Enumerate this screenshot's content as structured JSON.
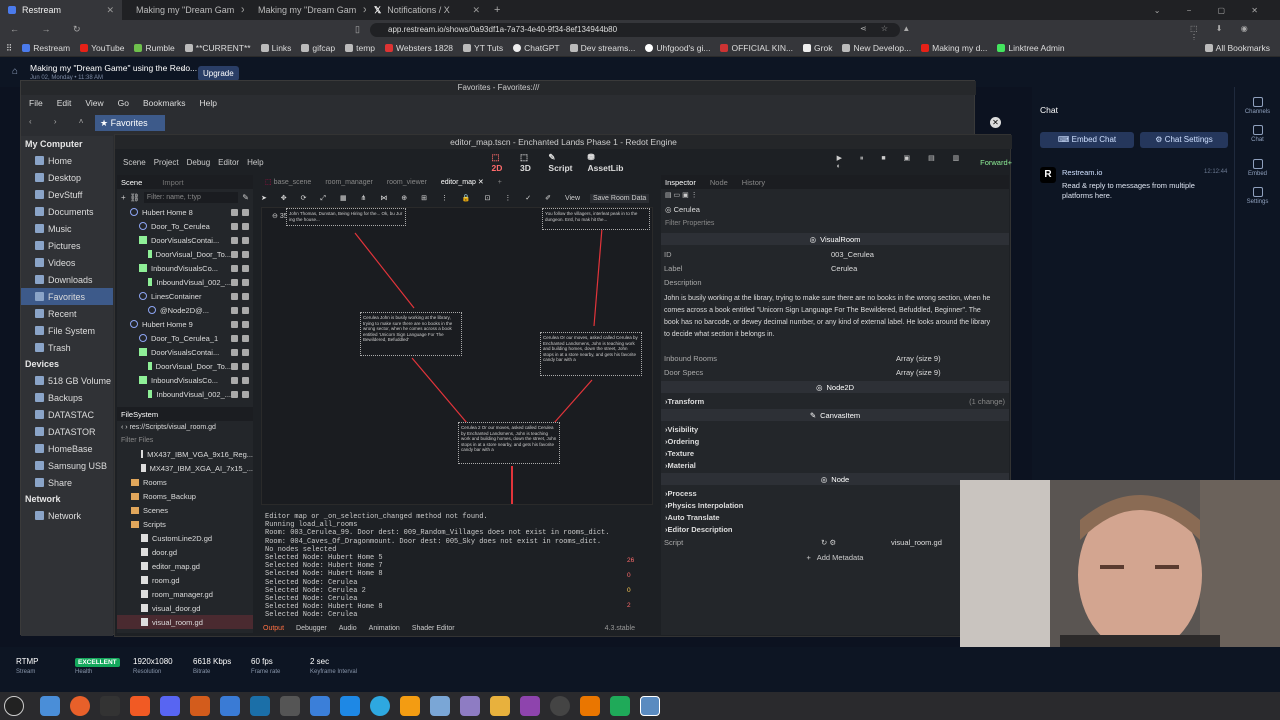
{
  "browser": {
    "tabs": [
      "Restream",
      "Making my \"Dream Gam",
      "Making my \"Dream Gam",
      "Notifications / X"
    ],
    "url": "app.restream.io/shows/0a93df1a-7a73-4e40-9f34-8ef134944b80",
    "bookmarks": [
      "Restream",
      "YouTube",
      "Rumble",
      "**CURRENT**",
      "Links",
      "gifcap",
      "temp",
      "Websters 1828",
      "YT Tuts",
      "ChatGPT",
      "Dev streams...",
      "Uhfgood's gi...",
      "OFFICIAL KIN...",
      "Grok",
      "New Develop...",
      "Making my d...",
      "Linktree Admin"
    ],
    "all_bookmarks": "All Bookmarks"
  },
  "restream": {
    "title": "Making my \"Dream Game\" using the Redo...",
    "subtitle": "Jun 02, Monday • 11:38 AM",
    "upgrade": "Upgrade"
  },
  "filemanager": {
    "title": "Favorites - Favorites:///",
    "menu": [
      "File",
      "Edit",
      "View",
      "Go",
      "Bookmarks",
      "Help"
    ],
    "location": "Favorites",
    "sidebar": {
      "my_computer": "My Computer",
      "places": [
        "Home",
        "Desktop",
        "DevStuff",
        "Documents",
        "Music",
        "Pictures",
        "Videos",
        "Downloads",
        "Favorites",
        "Recent",
        "File System",
        "Trash"
      ],
      "devices_h": "Devices",
      "devices": [
        "518 GB Volume",
        "Backups",
        "DATASTAC",
        "DATASTOR",
        "HomeBase",
        "Samsung USB",
        "Share"
      ],
      "network_h": "Network",
      "network": [
        "Network"
      ]
    }
  },
  "godot": {
    "title": "editor_map.tscn - Enchanted Lands Phase 1 - Redot Engine",
    "menu": [
      "Scene",
      "Project",
      "Debug",
      "Editor",
      "Help"
    ],
    "modes": [
      "2D",
      "3D",
      "Script",
      "AssetLib"
    ],
    "renderer": "Forward+",
    "scene_tabs": [
      "Scene",
      "Import"
    ],
    "filter_placeholder": "Filter: name, t:typ",
    "tree": [
      {
        "n": "Hubert Home 8",
        "t": "n",
        "d": 1
      },
      {
        "n": "Door_To_Cerulea",
        "t": "n",
        "d": 2
      },
      {
        "n": "DoorVisualsContai...",
        "t": "g",
        "d": 2
      },
      {
        "n": "DoorVisual_Door_To...",
        "t": "g",
        "d": 3
      },
      {
        "n": "InboundVisualsCo...",
        "t": "g",
        "d": 2
      },
      {
        "n": "InboundVisual_002_...",
        "t": "g",
        "d": 3
      },
      {
        "n": "LinesContainer",
        "t": "n",
        "d": 2
      },
      {
        "n": "@Node2D@...",
        "t": "n",
        "d": 3
      },
      {
        "n": "Hubert Home 9",
        "t": "n",
        "d": 1
      },
      {
        "n": "Door_To_Cerulea_1",
        "t": "n",
        "d": 2
      },
      {
        "n": "DoorVisualsContai...",
        "t": "g",
        "d": 2
      },
      {
        "n": "DoorVisual_Door_To...",
        "t": "g",
        "d": 3
      },
      {
        "n": "InboundVisualsCo...",
        "t": "g",
        "d": 2
      },
      {
        "n": "InboundVisual_002_...",
        "t": "g",
        "d": 3
      }
    ],
    "filesystem": {
      "title": "FileSystem",
      "path": "res://Scripts/visual_room.gd",
      "filter": "Filter Files",
      "items": [
        {
          "n": "MX437_IBM_VGA_9x16_Reg...",
          "t": "f",
          "d": 1
        },
        {
          "n": "MX437_IBM_XGA_AI_7x15_...",
          "t": "f",
          "d": 1
        },
        {
          "n": "Rooms",
          "t": "d",
          "d": 0
        },
        {
          "n": "Rooms_Backup",
          "t": "d",
          "d": 0
        },
        {
          "n": "Scenes",
          "t": "d",
          "d": 0
        },
        {
          "n": "Scripts",
          "t": "d",
          "d": 0
        },
        {
          "n": "CustomLine2D.gd",
          "t": "f",
          "d": 1
        },
        {
          "n": "door.gd",
          "t": "f",
          "d": 1
        },
        {
          "n": "editor_map.gd",
          "t": "f",
          "d": 1
        },
        {
          "n": "room.gd",
          "t": "f",
          "d": 1
        },
        {
          "n": "room_manager.gd",
          "t": "f",
          "d": 1
        },
        {
          "n": "visual_door.gd",
          "t": "f",
          "d": 1
        },
        {
          "n": "visual_room.gd",
          "t": "f",
          "d": 1
        }
      ]
    },
    "editor_tabs": [
      "base_scene",
      "room_manager",
      "room_viewer",
      "editor_map"
    ],
    "toolbar": {
      "view": "View",
      "save": "Save Room Data"
    },
    "zoom": "35.4 %",
    "nodes": {
      "top_left": "John Thomas, Dunstan, Being Hiring\nfor the... Ok, bu Jur ing the\nhouse...",
      "top_right": "You follow the villagers, interleat\npeak in to the dungeon. Entl, ho mak\nhit the...",
      "cerulea": "Cerulea\nJohn is busily working at the library,\ntrying to make sure there are no books\nin the wrong sector, when he comes\nacross a book entitled 'Unicorn Sign\nLanguage For The Bewildered, Befuddled'",
      "right": "Cerulea\nOr our moves, asked called Cerulea by\nEnchanted Landsmens, John is teaching work\nand building homes, down the street,\nJohn stops in at a store nearby, and\ngets his favorite candy bar with a",
      "bottom": "Cerulea 2\nOr our moves, asked called Cerulea by\nEnchanted Landsmens, John is teaching work\nand building homes, down the street,\nJohn stops in at a store nearby, and\ngets his favorite candy bar with a"
    },
    "output_lines": [
      "Editor map or _on_selection_changed method not found.",
      "Running load_all_rooms",
      "Room: 003_Cerulea_99. Door dest: 009_Random_Villages does not exist in rooms_dict.",
      "Room: 004_Caves_Of_Dragonmount. Door dest: 005_Sky does not exist in rooms_dict.",
      "No nodes selected",
      "Selected Node: Hubert Home 5",
      "Selected Node: Hubert Home 7",
      "Selected Node: Hubert Home 8",
      "Selected Node: Cerulea",
      "Selected Node: Cerulea 2",
      "Selected Node: Cerulea",
      "Selected Node: Hubert Home 8",
      "Selected Node: Cerulea"
    ],
    "bottom_tabs": [
      "Output",
      "Debugger",
      "Audio",
      "Animation",
      "Shader Editor"
    ],
    "version": "4.3.stable",
    "counters": [
      "26",
      "0",
      "0",
      "2"
    ],
    "inspector": {
      "tabs": [
        "Inspector",
        "Node",
        "History"
      ],
      "selected": "Cerulea",
      "filter": "Filter Properties",
      "class": "VisualRoom",
      "id_k": "ID",
      "id_v": "003_Cerulea",
      "label_k": "Label",
      "label_v": "Cerulea",
      "desc_k": "Description",
      "description": "John is busily working at the library, trying to make sure there are no books in the wrong section, when he comes across a book entitled \"Unicorn Sign Language For The Bewildered, Befuddled, Beginner\". The book has no barcode, or dewey decimal number, or any kind of external label. He looks around the library to decide what section it belongs in.",
      "inbound_k": "Inbound Rooms",
      "inbound_v": "Array (size 9)",
      "door_k": "Door Specs",
      "door_v": "Array (size 9)",
      "node2d": "Node2D",
      "transform": "Transform",
      "transform_note": "(1 change)",
      "canvasitem": "CanvasItem",
      "canvas_subs": [
        "Visibility",
        "Ordering",
        "Texture",
        "Material"
      ],
      "node": "Node",
      "node_subs": [
        "Process",
        "Physics Interpolation",
        "Auto Translate",
        "Editor Description"
      ],
      "script_k": "Script",
      "script_v": "visual_room.gd",
      "add_meta": "Add Metadata"
    }
  },
  "chat": {
    "title": "Chat",
    "embed": "Embed Chat",
    "settings": "Chat Settings",
    "sender": "Restream.io",
    "time": "12:12:44",
    "message": "Read & reply to messages from multiple platforms here.",
    "rail": [
      "Channels",
      "Chat",
      "Embed",
      "Settings"
    ]
  },
  "status": {
    "protocol": "RTMP",
    "protocol_l": "Stream",
    "health": "EXCELLENT",
    "health_l": "Health",
    "resolution": "1920x1080",
    "resolution_l": "Resolution",
    "bitrate": "6618 Kbps",
    "bitrate_l": "Bitrate",
    "fps": "60 fps",
    "fps_l": "Frame rate",
    "keyframe": "2 sec",
    "keyframe_l": "Keyframe Interval"
  }
}
